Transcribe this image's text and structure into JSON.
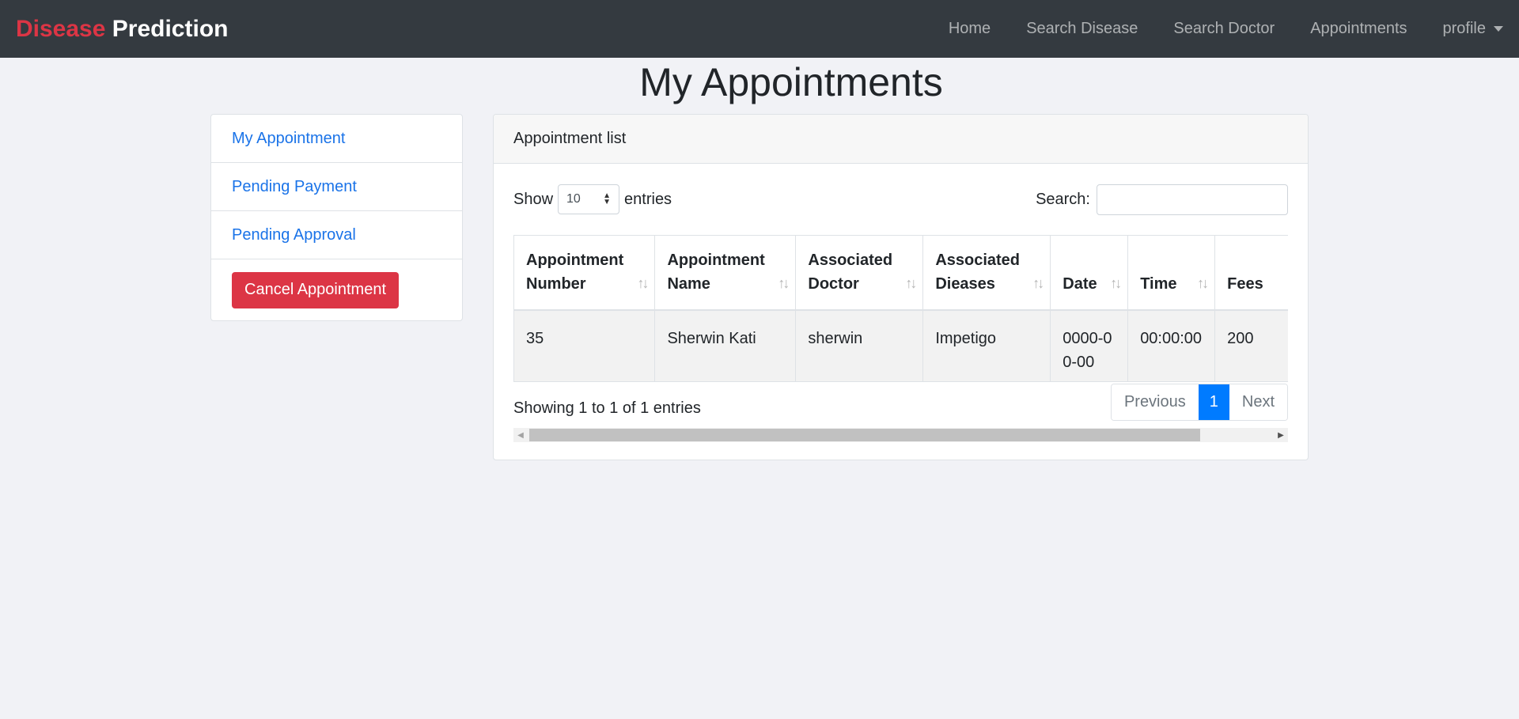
{
  "navbar": {
    "brand_part1": "Disease",
    "brand_part2": "Prediction",
    "links": [
      "Home",
      "Search Disease",
      "Search Doctor",
      "Appointments",
      "profile"
    ]
  },
  "page": {
    "title": "My Appointments"
  },
  "sidebar": {
    "items": [
      "My Appointment",
      "Pending Payment",
      "Pending Approval"
    ],
    "cancel_button": "Cancel Appointment"
  },
  "card": {
    "header": "Appointment list",
    "show_label": "Show",
    "entries_value": "10",
    "entries_label": "entries",
    "search_label": "Search:",
    "search_value": "",
    "columns": [
      [
        "Appointment",
        "Number"
      ],
      [
        "Appointment",
        "Name"
      ],
      [
        "Associated",
        "Doctor"
      ],
      [
        "Associated",
        "Dieases"
      ],
      [
        "",
        "Date"
      ],
      [
        "",
        "Time"
      ],
      [
        "",
        "Fees"
      ]
    ],
    "rows": [
      [
        "35",
        "Sherwin Kati",
        "sherwin",
        "Impetigo",
        "0000-00-00",
        "00:00:00",
        "200"
      ]
    ],
    "info": "Showing 1 to 1 of 1 entries",
    "pagination": {
      "previous": "Previous",
      "current": "1",
      "next": "Next"
    }
  },
  "colors": {
    "brand_red": "#dc3545",
    "navbar_bg": "#343a40",
    "link_blue": "#1a73e8",
    "active_blue": "#007bff"
  }
}
